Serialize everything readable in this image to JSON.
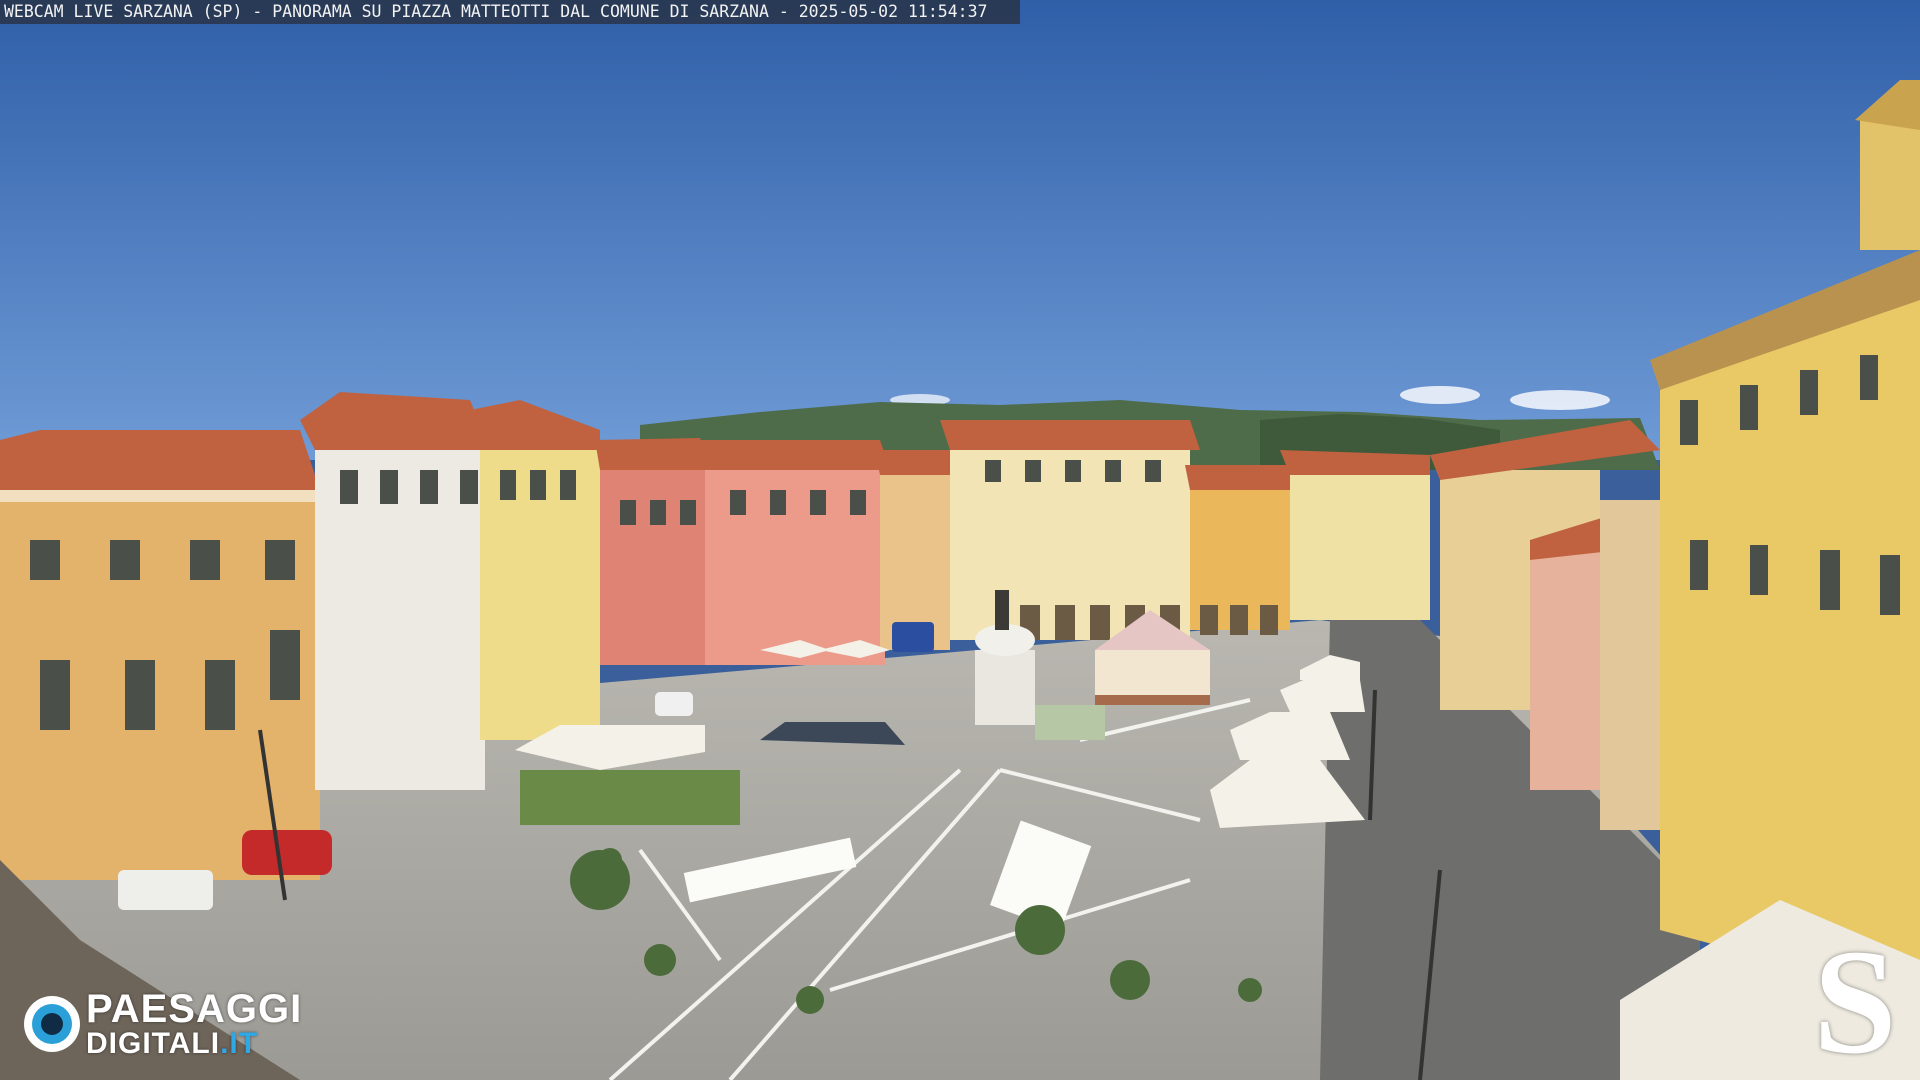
{
  "overlay": {
    "caption": "WEBCAM LIVE SARZANA (SP) - PANORAMA SU PIAZZA MATTEOTTI DAL COMUNE DI SARZANA - 2025-05-02  11:54:37"
  },
  "branding": {
    "left_logo_line1": "PAESAGGI",
    "left_logo_line2": "DIGITALI",
    "left_logo_suffix": ".IT",
    "right_logo_letter": "S"
  },
  "colors": {
    "sky": "#3f6fb8",
    "pavement": "#a9a8a3",
    "ochre_facade": "#e5b36e",
    "pink_facade": "#e08a7c",
    "yellow_facade": "#ead27a",
    "roof_tile": "#c0623f",
    "umbrella": "#f4f1e8",
    "logo_accent": "#2fa8e6"
  },
  "scene": {
    "subject": "webcam-view-town-square",
    "icons": [
      "camera-eye-logo-icon",
      "s-logo-icon"
    ]
  }
}
